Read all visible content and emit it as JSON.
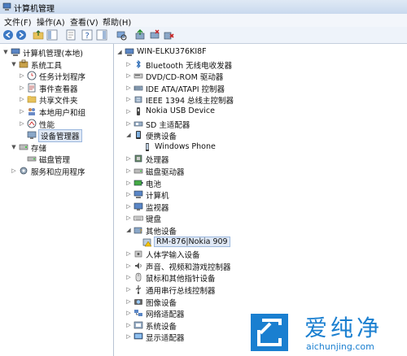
{
  "window": {
    "title": "计算机管理"
  },
  "menu": [
    "文件(F)",
    "操作(A)",
    "查看(V)",
    "帮助(H)"
  ],
  "left_tree": [
    {
      "label": "计算机管理(本地)",
      "level": 0,
      "expand": "▼",
      "icon": "computer-icon"
    },
    {
      "label": "系统工具",
      "level": 1,
      "expand": "▼",
      "icon": "tools-icon"
    },
    {
      "label": "任务计划程序",
      "level": 2,
      "expand": "▷",
      "icon": "clock-icon"
    },
    {
      "label": "事件查看器",
      "level": 2,
      "expand": "▷",
      "icon": "log-icon"
    },
    {
      "label": "共享文件夹",
      "level": 2,
      "expand": "▷",
      "icon": "folder-icon"
    },
    {
      "label": "本地用户和组",
      "level": 2,
      "expand": "▷",
      "icon": "users-icon"
    },
    {
      "label": "性能",
      "level": 2,
      "expand": "▷",
      "icon": "performance-icon"
    },
    {
      "label": "设备管理器",
      "level": 2,
      "expand": "",
      "icon": "device-manager-icon",
      "selected": true
    },
    {
      "label": "存储",
      "level": 1,
      "expand": "▼",
      "icon": "storage-icon"
    },
    {
      "label": "磁盘管理",
      "level": 2,
      "expand": "",
      "icon": "disk-icon"
    },
    {
      "label": "服务和应用程序",
      "level": 1,
      "expand": "▷",
      "icon": "services-icon"
    }
  ],
  "device_tree": [
    {
      "label": "WIN-ELKU376KI8F",
      "level": 0,
      "expand": "◢",
      "icon": "computer-icon"
    },
    {
      "label": "Bluetooth 无线电收发器",
      "level": 1,
      "expand": "▷",
      "icon": "bluetooth-icon"
    },
    {
      "label": "DVD/CD-ROM 驱动器",
      "level": 1,
      "expand": "▷",
      "icon": "dvd-icon"
    },
    {
      "label": "IDE ATA/ATAPI 控制器",
      "level": 1,
      "expand": "▷",
      "icon": "ide-icon"
    },
    {
      "label": "IEEE 1394 总线主控制器",
      "level": 1,
      "expand": "▷",
      "icon": "firewire-icon"
    },
    {
      "label": "Nokia USB Device",
      "level": 1,
      "expand": "▷",
      "icon": "usb-icon"
    },
    {
      "label": "SD 主适配器",
      "level": 1,
      "expand": "▷",
      "icon": "sd-icon"
    },
    {
      "label": "便携设备",
      "level": 1,
      "expand": "◢",
      "icon": "portable-device-icon"
    },
    {
      "label": "Windows Phone",
      "level": 2,
      "expand": "",
      "icon": "phone-icon"
    },
    {
      "label": "处理器",
      "level": 1,
      "expand": "▷",
      "icon": "cpu-icon"
    },
    {
      "label": "磁盘驱动器",
      "level": 1,
      "expand": "▷",
      "icon": "disk-icon"
    },
    {
      "label": "电池",
      "level": 1,
      "expand": "▷",
      "icon": "battery-icon"
    },
    {
      "label": "计算机",
      "level": 1,
      "expand": "▷",
      "icon": "computer-icon"
    },
    {
      "label": "监视器",
      "level": 1,
      "expand": "▷",
      "icon": "monitor-icon"
    },
    {
      "label": "键盘",
      "level": 1,
      "expand": "▷",
      "icon": "keyboard-icon"
    },
    {
      "label": "其他设备",
      "level": 1,
      "expand": "◢",
      "icon": "other-devices-icon"
    },
    {
      "label": "RM-876|Nokia 909",
      "level": 2,
      "expand": "",
      "icon": "warning-device-icon",
      "selected": true
    },
    {
      "label": "人体学输入设备",
      "level": 1,
      "expand": "▷",
      "icon": "hid-icon"
    },
    {
      "label": "声音、视频和游戏控制器",
      "level": 1,
      "expand": "▷",
      "icon": "sound-icon"
    },
    {
      "label": "鼠标和其他指针设备",
      "level": 1,
      "expand": "▷",
      "icon": "mouse-icon"
    },
    {
      "label": "通用串行总线控制器",
      "level": 1,
      "expand": "▷",
      "icon": "usb-controller-icon"
    },
    {
      "label": "图像设备",
      "level": 1,
      "expand": "▷",
      "icon": "camera-icon"
    },
    {
      "label": "网络适配器",
      "level": 1,
      "expand": "▷",
      "icon": "network-icon"
    },
    {
      "label": "系统设备",
      "level": 1,
      "expand": "▷",
      "icon": "system-icon"
    },
    {
      "label": "显示适配器",
      "level": 1,
      "expand": "▷",
      "icon": "display-icon"
    }
  ],
  "watermark": {
    "brand": "爱纯净",
    "url": "aichunjing.com"
  },
  "colors": {
    "accent": "#1a7fd0",
    "selection": "#dfe8f5"
  }
}
